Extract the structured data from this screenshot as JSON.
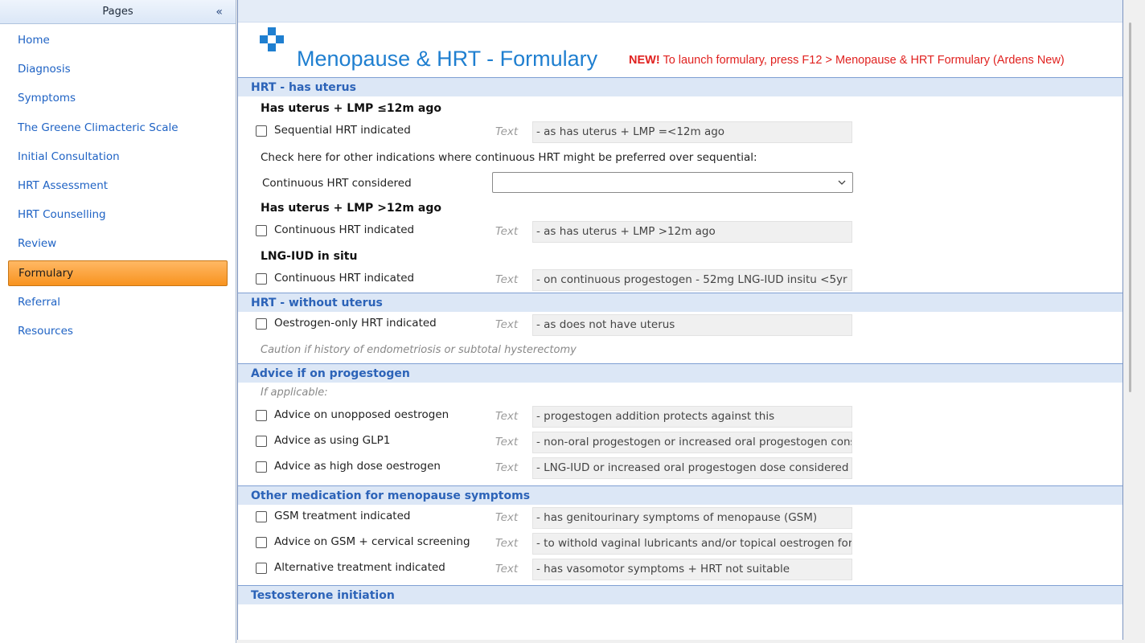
{
  "sidebar": {
    "header": "Pages",
    "collapse_icon": "«",
    "items": [
      {
        "label": "Home"
      },
      {
        "label": "Diagnosis"
      },
      {
        "label": "Symptoms"
      },
      {
        "label": "The Greene Climacteric Scale"
      },
      {
        "label": "Initial Consultation"
      },
      {
        "label": "HRT Assessment"
      },
      {
        "label": "HRT Counselling"
      },
      {
        "label": "Review"
      },
      {
        "label": "Formulary",
        "active": true
      },
      {
        "label": "Referral"
      },
      {
        "label": "Resources"
      }
    ]
  },
  "title": {
    "text": "Menopause & HRT - Formulary",
    "new_badge": "NEW!",
    "notice": " To launch formulary, press F12 > Menopause & HRT Formulary (Ardens New)"
  },
  "sections": {
    "has_uterus": {
      "header": "HRT - has uterus",
      "sub1": "Has uterus + LMP ≤12m ago",
      "row1": {
        "label": "Sequential HRT indicated",
        "text_label": "Text",
        "value": "- as has uterus + LMP =<12m ago"
      },
      "info": "Check here for other indications where continuous HRT might be preferred over sequential:",
      "dropdown": {
        "label": "Continuous HRT considered",
        "value": ""
      },
      "sub2": "Has uterus + LMP >12m ago",
      "row2": {
        "label": "Continuous HRT indicated",
        "text_label": "Text",
        "value": "- as has uterus + LMP >12m ago"
      },
      "sub3": "LNG-IUD in situ",
      "row3": {
        "label": "Continuous HRT indicated",
        "text_label": "Text",
        "value": "- on continuous progestogen - 52mg LNG-IUD insitu <5yr"
      }
    },
    "without_uterus": {
      "header": "HRT - without uterus",
      "row1": {
        "label": "Oestrogen-only HRT indicated",
        "text_label": "Text",
        "value": "- as does not have uterus"
      },
      "note": "Caution if history of endometriosis or subtotal hysterectomy"
    },
    "progestogen": {
      "header": "Advice if on progestogen",
      "note": "If applicable:",
      "row1": {
        "label": "Advice on unopposed oestrogen",
        "text_label": "Text",
        "value": "- progestogen addition protects against this"
      },
      "row2": {
        "label": "Advice as using GLP1",
        "text_label": "Text",
        "value": "- non-oral progestogen or increased oral progestogen considered"
      },
      "row3": {
        "label": "Advice as high dose oestrogen",
        "text_label": "Text",
        "value": "- LNG-IUD or increased oral progestogen dose considered"
      }
    },
    "other_meds": {
      "header": "Other medication for menopause symptoms",
      "row1": {
        "label": "GSM treatment indicated",
        "text_label": "Text",
        "value": "- has genitourinary symptoms of menopause (GSM)"
      },
      "row2": {
        "label": "Advice on GSM + cervical screening",
        "text_label": "Text",
        "value": "- to withold vaginal lubricants and/or topical oestrogen for"
      },
      "row3": {
        "label": "Alternative treatment indicated",
        "text_label": "Text",
        "value": "- has vasomotor symptoms + HRT not suitable"
      }
    },
    "testosterone": {
      "header": "Testosterone initiation"
    }
  },
  "colors": {
    "accent": "#1f7fd0",
    "section_header_text": "#2c63b8",
    "notice": "#e0211f",
    "active_nav": "#f8931f"
  },
  "icons": {
    "logo": "blue-cross-logo-icon",
    "checkbox": "checkbox-icon",
    "dropdown": "chevron-down-icon",
    "collapse": "double-chevron-left-icon"
  }
}
